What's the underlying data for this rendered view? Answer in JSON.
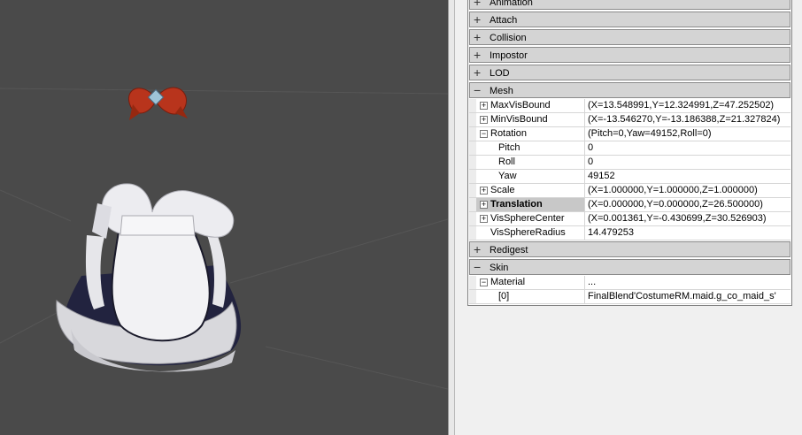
{
  "categories": {
    "animation": {
      "label": "Animation",
      "symbol": "+"
    },
    "attach": {
      "label": "Attach",
      "symbol": "+"
    },
    "collision": {
      "label": "Collision",
      "symbol": "+"
    },
    "impostor": {
      "label": "Impostor",
      "symbol": "+"
    },
    "lod": {
      "label": "LOD",
      "symbol": "+"
    },
    "mesh": {
      "label": "Mesh",
      "symbol": "−"
    },
    "redigest": {
      "label": "Redigest",
      "symbol": "+"
    },
    "skin": {
      "label": "Skin",
      "symbol": "−"
    }
  },
  "mesh_props": {
    "maxvisbound": {
      "name": "MaxVisBound",
      "value": "(X=13.548991,Y=12.324991,Z=47.252502)",
      "toggle": "+"
    },
    "minvisbound": {
      "name": "MinVisBound",
      "value": "(X=-13.546270,Y=-13.186388,Z=21.327824)",
      "toggle": "+"
    },
    "rotation": {
      "name": "Rotation",
      "value": "(Pitch=0,Yaw=49152,Roll=0)",
      "toggle": "−"
    },
    "pitch": {
      "name": "Pitch",
      "value": "0"
    },
    "roll": {
      "name": "Roll",
      "value": "0"
    },
    "yaw": {
      "name": "Yaw",
      "value": "49152"
    },
    "scale": {
      "name": "Scale",
      "value": "(X=1.000000,Y=1.000000,Z=1.000000)",
      "toggle": "+"
    },
    "translation": {
      "name": "Translation",
      "value": "(X=0.000000,Y=0.000000,Z=26.500000)",
      "toggle": "+"
    },
    "vissphere_center": {
      "name": "VisSphereCenter",
      "value": "(X=0.001361,Y=-0.430699,Z=30.526903)",
      "toggle": "+"
    },
    "vissphere_radius": {
      "name": "VisSphereRadius",
      "value": "14.479253"
    }
  },
  "skin_props": {
    "material": {
      "name": "Material",
      "value": "...",
      "toggle": "−"
    },
    "material_0": {
      "name": "[0]",
      "value": "FinalBlend'CostumeRM.maid.g_co_maid_s'"
    }
  },
  "colors": {
    "viewport_bg": "#4a4a4a",
    "category_bg": "#d4d4d4",
    "selected_name_bg": "#c8c8c8"
  }
}
